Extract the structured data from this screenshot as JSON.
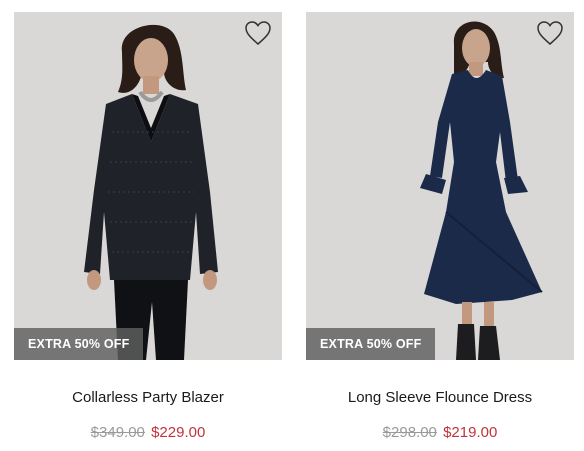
{
  "products": [
    {
      "name": "Collarless Party Blazer",
      "original_price": "$349.00",
      "sale_price": "$229.00",
      "badge": "EXTRA 50% OFF",
      "wishlist_icon": "heart-outline-icon"
    },
    {
      "name": "Long Sleeve Flounce Dress",
      "original_price": "$298.00",
      "sale_price": "$219.00",
      "badge": "EXTRA 50% OFF",
      "wishlist_icon": "heart-outline-icon"
    }
  ],
  "colors": {
    "sale_price": "#c0333a",
    "original_price": "#9a9a9a",
    "badge_bg": "#5f5f5f",
    "photo_bg": "#d9d8d6"
  }
}
